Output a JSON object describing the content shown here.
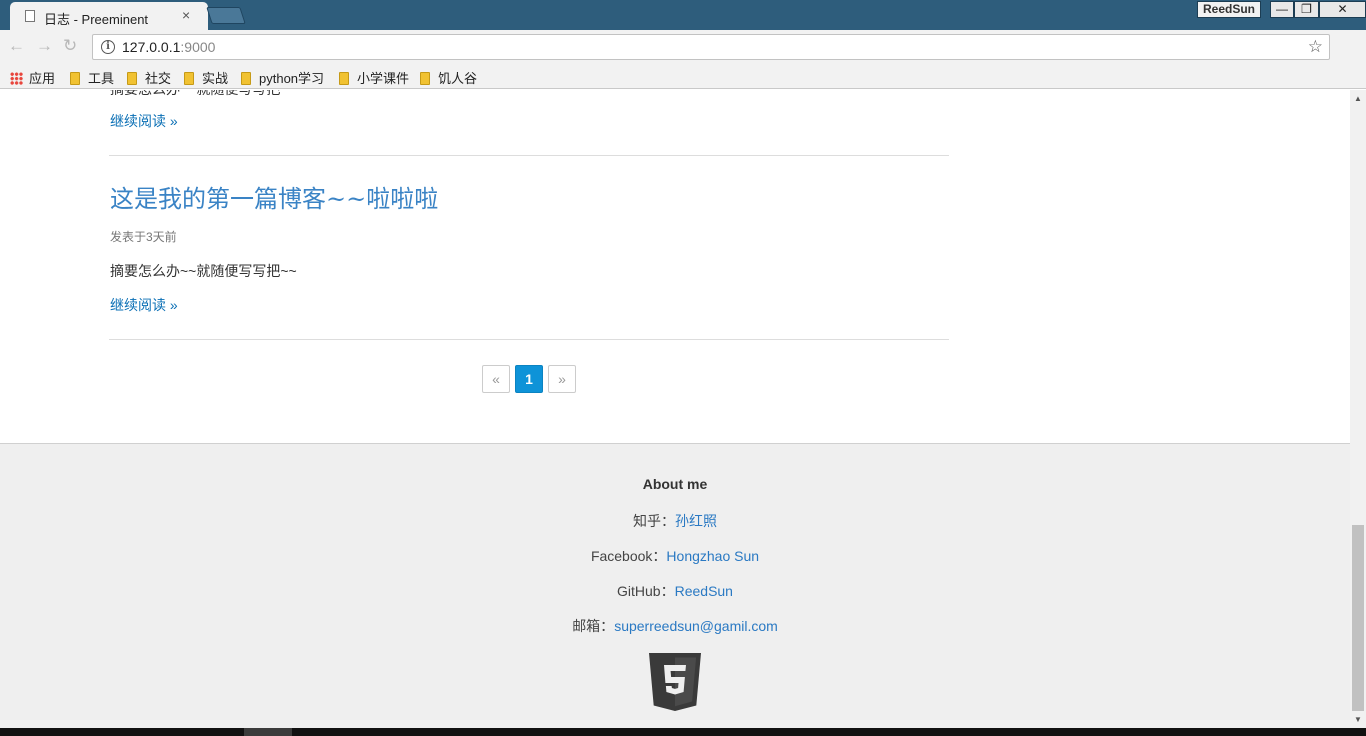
{
  "browser": {
    "tab_title": "日志 - Preeminent",
    "tab_close": "×",
    "profile_name": "ReedSun",
    "window_controls": {
      "minimize": "—",
      "maximize": "❐",
      "close": "✕"
    },
    "url_host": "127.0.0.1",
    "url_port": ":9000",
    "bookmarks": [
      {
        "label": "应用",
        "icon": "apps-grid-icon"
      },
      {
        "label": "工具",
        "icon": "folder-icon"
      },
      {
        "label": "社交",
        "icon": "folder-icon"
      },
      {
        "label": "实战",
        "icon": "folder-icon"
      },
      {
        "label": "python学习",
        "icon": "folder-icon"
      },
      {
        "label": "小学课件",
        "icon": "folder-icon"
      },
      {
        "label": "饥人谷",
        "icon": "folder-icon"
      }
    ]
  },
  "posts": {
    "cut_previous_summary": "摘要怎么办~~就随便写写把~~",
    "read_more_label": "继续阅读 »",
    "items": [
      {
        "title": "这是我的第一篇博客~~啦啦啦",
        "meta": "发表于3天前",
        "summary": "摘要怎么办~~就随便写写把~~",
        "read_more": "继续阅读 »"
      }
    ]
  },
  "pagination": {
    "prev": "«",
    "current": "1",
    "next": "»"
  },
  "footer": {
    "title": "About me",
    "zhihu_label": "知乎：",
    "zhihu_value": "孙红照",
    "facebook_label": "Facebook：",
    "facebook_value": "Hongzhao Sun",
    "github_label": "GitHub：",
    "github_value": "ReedSun",
    "email_label": "邮箱：",
    "email_value": "superreedsun@gamil.com",
    "logo_icon": "html5-logo-icon"
  },
  "colors": {
    "link": "#0a6fb5",
    "title": "#3a83c5",
    "pager_active": "#0e93d8",
    "footer_bg": "#efefef",
    "titlebar": "#2e5d7c"
  }
}
